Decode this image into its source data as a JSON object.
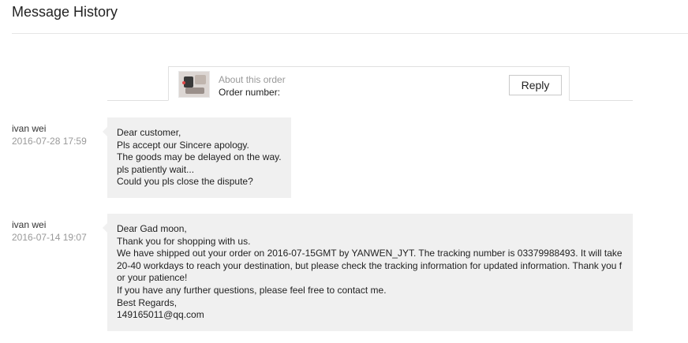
{
  "page": {
    "title": "Message History"
  },
  "order": {
    "about_label": "About this order",
    "order_number_label": "Order number:",
    "reply_label": "Reply"
  },
  "messages": [
    {
      "sender": "ivan wei",
      "time": "2016-07-28 17:59",
      "lines": [
        "Dear customer,",
        "Pls accept our Sincere apology.",
        "The goods may be delayed on the way.",
        "pls patiently wait...",
        "Could you pls close the dispute?"
      ]
    },
    {
      "sender": "ivan wei",
      "time": "2016-07-14 19:07",
      "lines": [
        "Dear Gad moon,",
        "Thank you for shopping with us.",
        "We have shipped out your order on 2016-07-15GMT by YANWEN_JYT. The tracking number is 03379988493. It will take 20-40 workdays to reach your destination, but please check the tracking information for updated information. Thank you for your patience!",
        "If you have any further questions, please feel free to contact me.",
        "Best Regards,",
        "149165011@qq.com"
      ]
    }
  ],
  "colors": {
    "bubble_bg": "#f0f0f0",
    "muted_text": "#999999",
    "border": "#e0e0e0"
  },
  "icons": {
    "product_thumbnail": "product-thumbnail-image"
  }
}
